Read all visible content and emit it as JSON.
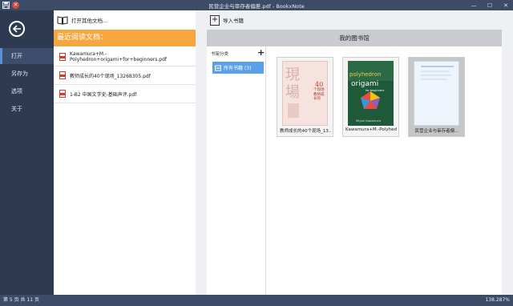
{
  "titlebar": {
    "title": "民营企业与审存者偏差.pdf - BookxNote",
    "close_glyph": "✕",
    "minimize": "—",
    "maximize": "☐",
    "close": "✕"
  },
  "nav": {
    "items": [
      {
        "label": "打开"
      },
      {
        "label": "另存为"
      },
      {
        "label": "选项"
      },
      {
        "label": "关于"
      }
    ]
  },
  "recent": {
    "open_other_label": "打开其他文档...",
    "header": "最近阅读文档：",
    "files": [
      {
        "name": "Kawamura+M.-Polyhedron+origami+for+beginners.pdf"
      },
      {
        "name": "教师成长的40个现场_13268305.pdf"
      },
      {
        "name": "1-B2 中国文学史-基础声评.pdf"
      }
    ]
  },
  "library": {
    "import_label": "导入书籍",
    "header": "我的图书馆",
    "shelf_header": "书架分类",
    "add_glyph": "+",
    "shelf_item": "所有书籍 (3)",
    "books": [
      {
        "caption": "教师成长的40个现场_13...",
        "cover_text_top": "40",
        "cover_text": "个现场 教师成长的"
      },
      {
        "caption": "Kawamura+M.-Polyhedr...",
        "cover_title1": "polyhedron",
        "cover_title2": "origami",
        "cover_sub": "for beginners",
        "cover_author": "Miyuki Kawamura"
      },
      {
        "caption": "民营企业与审存者偏..."
      }
    ]
  },
  "status": {
    "page": "第 5 页 共 11 页",
    "zoom": "138.287%"
  },
  "colors": {
    "titlebar": "#3c4b66",
    "sidebar": "#2d3a52",
    "accent_orange": "#f6a63f",
    "shelf_selected": "#5aa0e6"
  }
}
